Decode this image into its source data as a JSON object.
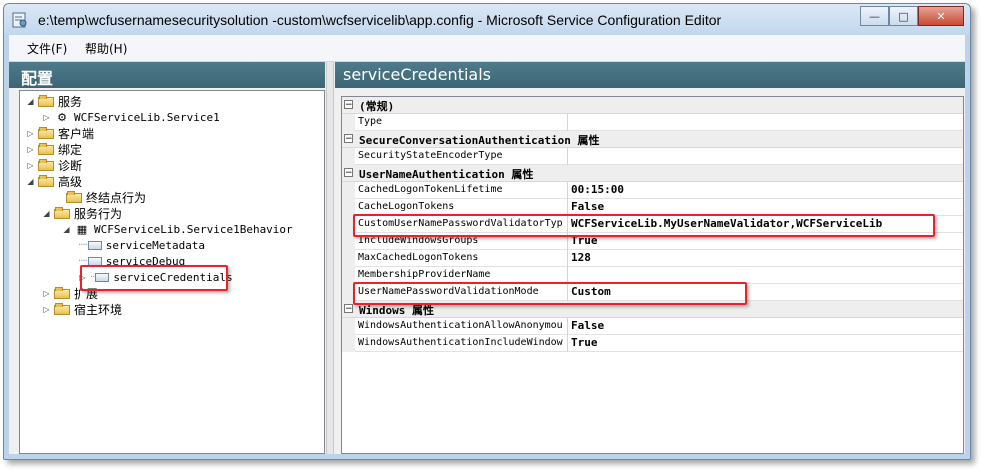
{
  "window": {
    "title": "e:\\temp\\wcfusernamesecuritysolution -custom\\wcfservicelib\\app.config - Microsoft Service Configuration Editor",
    "controls": [
      "minimize",
      "maximize",
      "close"
    ]
  },
  "menu": {
    "file": "文件(F)",
    "help": "帮助(H)"
  },
  "left_panel": {
    "header": "配置",
    "tree": [
      {
        "label": "服务"
      },
      {
        "label": "WCFServiceLib.Service1"
      },
      {
        "label": "客户端"
      },
      {
        "label": "绑定"
      },
      {
        "label": "诊断"
      },
      {
        "label": "高级"
      },
      {
        "label": "终结点行为"
      },
      {
        "label": "服务行为"
      },
      {
        "label": "WCFServiceLib.Service1Behavior"
      },
      {
        "label": "serviceMetadata"
      },
      {
        "label": "serviceDebug"
      },
      {
        "label": "serviceCredentials"
      },
      {
        "label": "扩展"
      },
      {
        "label": "宿主环境"
      }
    ]
  },
  "right_panel": {
    "header": "serviceCredentials",
    "grid": [
      {
        "category": "(常规)"
      },
      {
        "name": "Type",
        "value": ""
      },
      {
        "category": "SecureConversationAuthentication 属性"
      },
      {
        "name": "SecurityStateEncoderType",
        "value": ""
      },
      {
        "category": "UserNameAuthentication 属性"
      },
      {
        "name": "CachedLogonTokenLifetime",
        "value": "00:15:00"
      },
      {
        "name": "CacheLogonTokens",
        "value": "False"
      },
      {
        "name": "CustomUserNamePasswordValidatorTyp",
        "value": "WCFServiceLib.MyUserNameValidator,WCFServiceLib"
      },
      {
        "name": "IncludeWindowsGroups",
        "value": "True"
      },
      {
        "name": "MaxCachedLogonTokens",
        "value": "128"
      },
      {
        "name": "MembershipProviderName",
        "value": ""
      },
      {
        "name": "UserNamePasswordValidationMode",
        "value": "Custom"
      },
      {
        "category": "Windows 属性"
      },
      {
        "name": "WindowsAuthenticationAllowAnonymou",
        "value": "False"
      },
      {
        "name": "WindowsAuthenticationIncludeWindow",
        "value": "True"
      }
    ]
  },
  "colors": {
    "highlight_border": "#e8232d",
    "pane_header": "#3b6676",
    "window_frame": "#bcd3ea"
  }
}
